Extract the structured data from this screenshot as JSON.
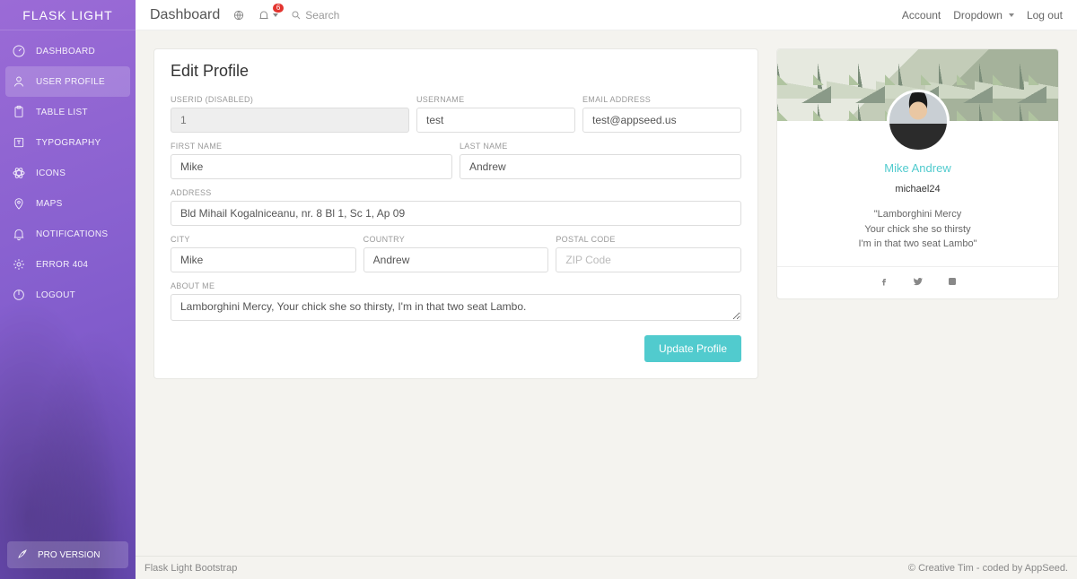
{
  "brand": "FLASK LIGHT",
  "sidebar": {
    "items": [
      {
        "label": "DASHBOARD",
        "icon": "gauge"
      },
      {
        "label": "USER PROFILE",
        "icon": "user",
        "active": true
      },
      {
        "label": "TABLE LIST",
        "icon": "clipboard"
      },
      {
        "label": "TYPOGRAPHY",
        "icon": "text"
      },
      {
        "label": "ICONS",
        "icon": "atom"
      },
      {
        "label": "MAPS",
        "icon": "pin"
      },
      {
        "label": "NOTIFICATIONS",
        "icon": "bell"
      },
      {
        "label": "ERROR 404",
        "icon": "gear"
      },
      {
        "label": "LOGOUT",
        "icon": "power"
      }
    ],
    "pro": "PRO VERSION"
  },
  "topbar": {
    "title": "Dashboard",
    "badge": "6",
    "search_placeholder": "Search",
    "links": {
      "account": "Account",
      "dropdown": "Dropdown",
      "logout": "Log out"
    }
  },
  "edit": {
    "heading": "Edit Profile",
    "labels": {
      "userid": "USERID (DISABLED)",
      "username": "USERNAME",
      "email": "EMAIL ADDRESS",
      "firstname": "FIRST NAME",
      "lastname": "LAST NAME",
      "address": "ADDRESS",
      "city": "CITY",
      "country": "COUNTRY",
      "postal": "POSTAL CODE",
      "about": "ABOUT ME"
    },
    "values": {
      "userid": "1",
      "username": "test",
      "email": "test@appseed.us",
      "firstname": "Mike",
      "lastname": "Andrew",
      "address": "Bld Mihail Kogalniceanu, nr. 8 Bl 1, Sc 1, Ap 09",
      "city": "Mike",
      "country": "Andrew",
      "postal": "",
      "about": "Lamborghini Mercy, Your chick she so thirsty, I'm in that two seat Lambo."
    },
    "placeholders": {
      "postal": "ZIP Code"
    },
    "button": "Update Profile"
  },
  "user_card": {
    "name": "Mike Andrew",
    "handle": "michael24",
    "quote1": "\"Lamborghini Mercy",
    "quote2": "Your chick she so thirsty",
    "quote3": "I'm in that two seat Lambo\""
  },
  "footer": {
    "left": "Flask Light Bootstrap",
    "right": "© Creative Tim - coded by AppSeed."
  }
}
